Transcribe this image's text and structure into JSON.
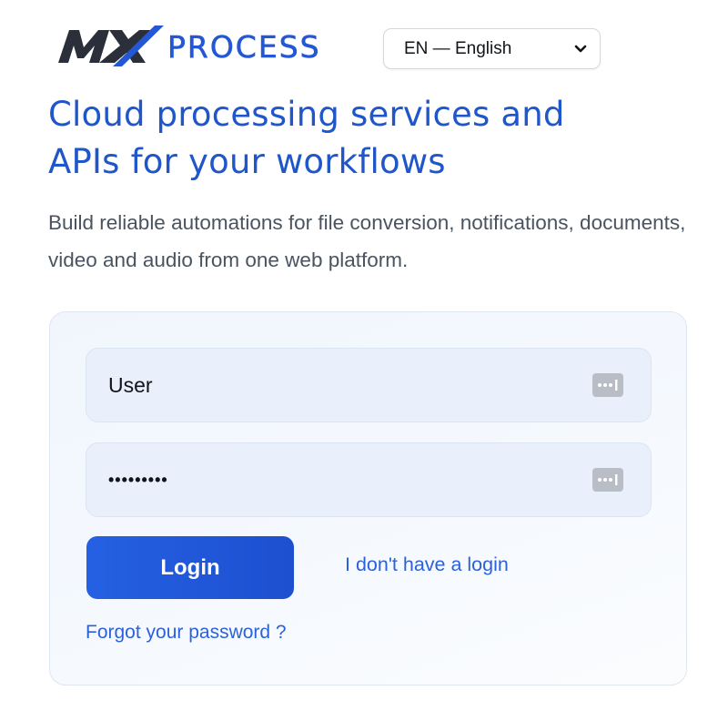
{
  "brand": {
    "logo_text": "MX PROCESS",
    "mark_color": "#2a2f3a",
    "accent_color": "#2457d6"
  },
  "header": {
    "language_select": {
      "selected": "EN — English"
    }
  },
  "hero": {
    "headline_line1": "Cloud processing services and",
    "headline_line2": "APIs for your workflows",
    "intro": "Build reliable automations for file conversion, notifications, documents, video and audio from one web platform.",
    "headline_color": "#1f56c9"
  },
  "login": {
    "username_value": "User",
    "password_value": "•••••••••",
    "field_icon": "password-manager-icon",
    "login_button_label": "Login",
    "no_login_link": "I don't have a login",
    "forgot_link": "Forgot your password ?",
    "button_color": "#2461e2",
    "link_color": "#2b62d9"
  }
}
